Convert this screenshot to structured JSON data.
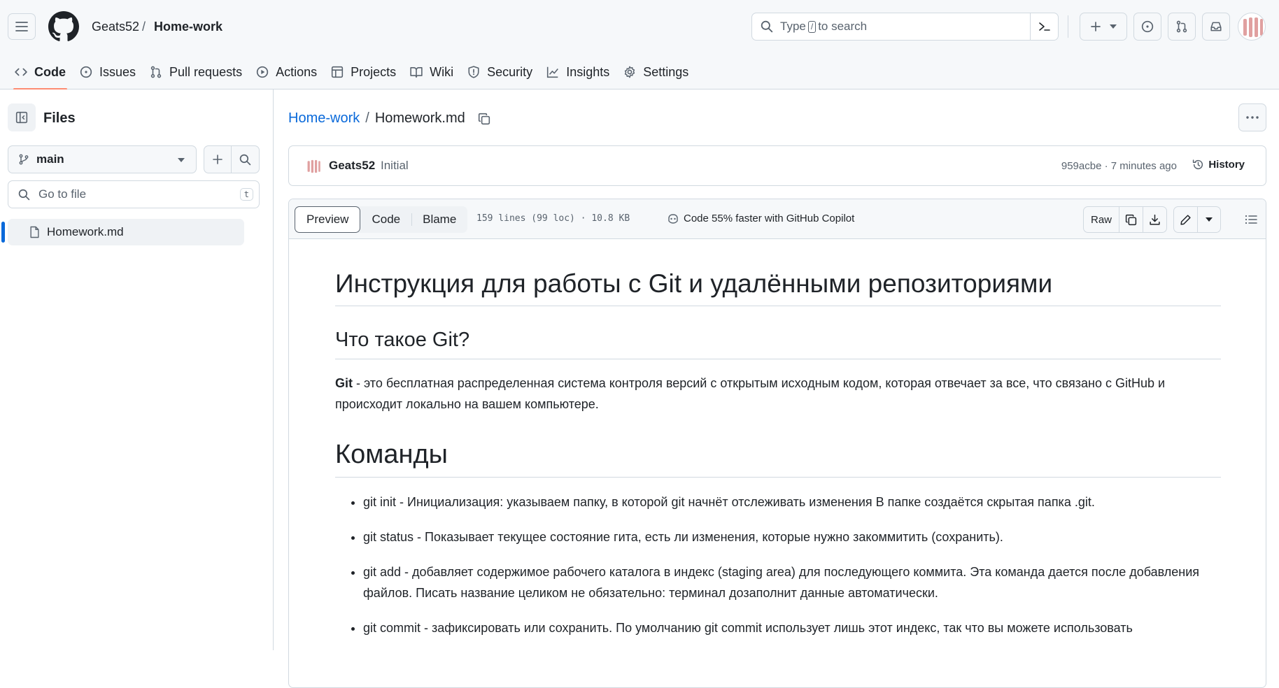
{
  "header": {
    "owner": "Geats52",
    "separator": "/",
    "repo": "Home-work",
    "search": {
      "prefix": "Type",
      "key": "/",
      "suffix": "to search"
    }
  },
  "nav": [
    {
      "label": "Code",
      "icon": "code-icon",
      "active": true
    },
    {
      "label": "Issues",
      "icon": "issue-icon"
    },
    {
      "label": "Pull requests",
      "icon": "pull-request-icon"
    },
    {
      "label": "Actions",
      "icon": "play-icon"
    },
    {
      "label": "Projects",
      "icon": "table-icon"
    },
    {
      "label": "Wiki",
      "icon": "book-icon"
    },
    {
      "label": "Security",
      "icon": "shield-icon"
    },
    {
      "label": "Insights",
      "icon": "graph-icon"
    },
    {
      "label": "Settings",
      "icon": "gear-icon"
    }
  ],
  "sidebar": {
    "title": "Files",
    "branch": "main",
    "goto_placeholder": "Go to file",
    "goto_key": "t",
    "files": [
      "Homework.md"
    ]
  },
  "file": {
    "repo_link": "Home-work",
    "sep": "/",
    "name": "Homework.md",
    "commit": {
      "author": "Geats52",
      "message": "Initial",
      "meta": "959acbe · 7 minutes ago",
      "history_label": "History"
    },
    "tabs": [
      "Preview",
      "Code",
      "Blame"
    ],
    "info": "159 lines (99 loc) · 10.8 KB",
    "copilot": "Code 55% faster with GitHub Copilot",
    "raw_label": "Raw"
  },
  "markdown": {
    "h1": "Инструкция для работы с Git и удалёнными репозиториями",
    "h2": "Что такое Git?",
    "para_bold": "Git",
    "para_rest": " - это бесплатная распределенная система контроля версий с открытым исходным кодом, которая отвечает за все, что связано с GitHub и происходит локально на вашем компьютере.",
    "h1b": "Команды",
    "items": [
      "git init - Инициализация: указываем папку, в которой git начнёт отслеживать изменения В папке создаётся скрытая папка .git.",
      "git status - Показывает текущее состояние гита, есть ли изменения, которые нужно закоммитить (сохранить).",
      "git add - добавляет содержимое рабочего каталога в индекс (staging area) для последующего коммита. Эта команда дается после добавления файлов. Писать название целиком не обязательно: терминал дозаполнит данные автоматически.",
      "git commit - зафиксировать или сохранить. По умолчанию git commit использует лишь этот индекс, так что вы можете использовать"
    ]
  },
  "colors": {
    "accent": "#0969da",
    "nav_underline": "#fd8c73",
    "avatar": "#e0a0a0"
  }
}
